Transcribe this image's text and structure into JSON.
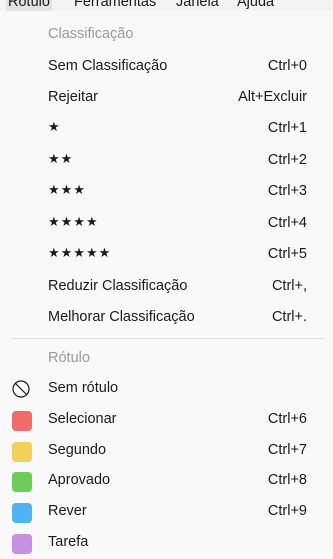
{
  "menubar": {
    "items": [
      "Rótulo",
      "Ferramentas",
      "Janela",
      "Ajuda"
    ]
  },
  "menu": {
    "rating_header": "Classificação",
    "rating_items": [
      {
        "label": "Sem Classificação",
        "shortcut": "Ctrl+0"
      },
      {
        "label": "Rejeitar",
        "shortcut": "Alt+Excluir"
      },
      {
        "label": "★",
        "shortcut": "Ctrl+1"
      },
      {
        "label": "★★",
        "shortcut": "Ctrl+2"
      },
      {
        "label": "★★★",
        "shortcut": "Ctrl+3"
      },
      {
        "label": "★★★★",
        "shortcut": "Ctrl+4"
      },
      {
        "label": "★★★★★",
        "shortcut": "Ctrl+5"
      },
      {
        "label": "Reduzir Classificação",
        "shortcut": "Ctrl+,"
      },
      {
        "label": "Melhorar Classificação",
        "shortcut": "Ctrl+."
      }
    ],
    "label_header": "Rótulo",
    "label_items": [
      {
        "label": "Sem rótulo",
        "shortcut": "",
        "color": ""
      },
      {
        "label": "Selecionar",
        "shortcut": "Ctrl+6",
        "color": "#f06b6b"
      },
      {
        "label": "Segundo",
        "shortcut": "Ctrl+7",
        "color": "#f2d15a"
      },
      {
        "label": "Aprovado",
        "shortcut": "Ctrl+8",
        "color": "#6fcb5a"
      },
      {
        "label": "Rever",
        "shortcut": "Ctrl+9",
        "color": "#4fb2f2"
      },
      {
        "label": "Tarefa",
        "shortcut": "",
        "color": "#c591e0"
      }
    ]
  }
}
